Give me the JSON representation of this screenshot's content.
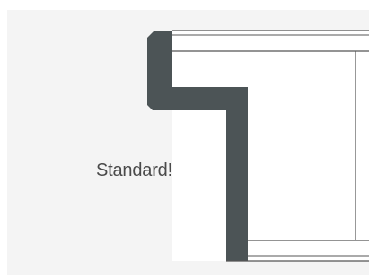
{
  "diagram": {
    "label": "Standard!",
    "colors": {
      "background": "#f4f4f4",
      "profile_fill": "#4c5456",
      "line": "#555555",
      "text": "#4a4a4a"
    }
  }
}
